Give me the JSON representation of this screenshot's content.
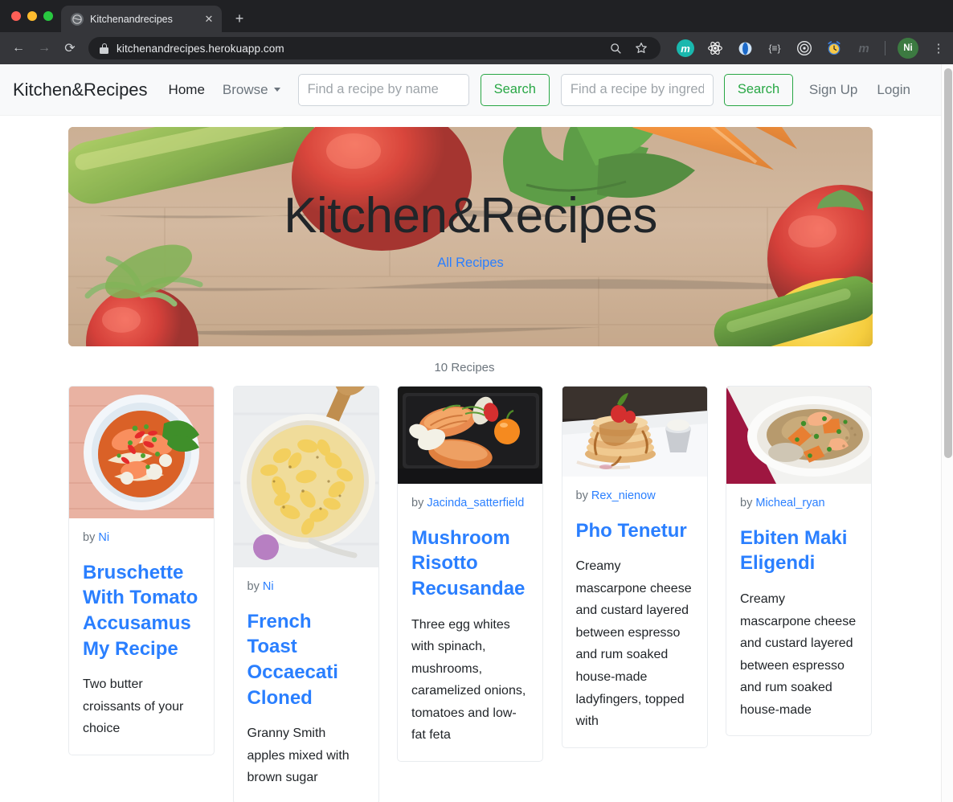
{
  "browser": {
    "tab": {
      "title": "Kitchenandrecipes",
      "favicon": "globe-icon",
      "close": "✕"
    },
    "new_tab": "+",
    "nav": {
      "back": "←",
      "forward": "→",
      "reload": "⟳"
    },
    "omnibox": {
      "url": "kitchenandrecipes.herokuapp.com",
      "lock": "lock-icon",
      "zoom_search": "⚲",
      "bookmark": "☆"
    },
    "extensions": [
      {
        "name": "mendeley-extension-icon",
        "glyph": "m"
      },
      {
        "name": "react-devtools-icon",
        "glyph": "⚛"
      },
      {
        "name": "opera-extension-icon",
        "glyph": "◐"
      },
      {
        "name": "code-extension-icon",
        "glyph": "{≡}"
      },
      {
        "name": "target-extension-icon",
        "glyph": "◎"
      },
      {
        "name": "alarm-clock-extension-icon",
        "glyph": "⏰"
      },
      {
        "name": "grayed-extension-icon",
        "glyph": "m"
      }
    ],
    "profile_initials": "Ni",
    "menu": "⋮"
  },
  "site": {
    "brand": "Kitchen&Recipes",
    "nav_items": [
      {
        "label": "Home",
        "muted": false
      },
      {
        "label": "Browse",
        "muted": true,
        "has_caret": true
      }
    ],
    "search_name": {
      "placeholder": "Find a recipe by name",
      "value": ""
    },
    "search_name_button": "Search",
    "search_ingredient": {
      "placeholder": "Find a recipe by ingredient",
      "value": ""
    },
    "search_ingredient_button": "Search",
    "auth": [
      {
        "label": "Sign Up"
      },
      {
        "label": "Login"
      }
    ]
  },
  "hero": {
    "title": "Kitchen&Recipes",
    "link": "All Recipes"
  },
  "results": {
    "count_label": "10 Recipes",
    "cards": [
      {
        "image": "noodle-soup-photo",
        "by_prefix": "by",
        "author": "Ni",
        "title": "Bruschette With Tomato Accusamus My Recipe",
        "description": "Two butter croissants of your choice"
      },
      {
        "image": "mac-and-cheese-photo",
        "by_prefix": "by",
        "author": "Ni",
        "title": "French Toast Occaecati Cloned",
        "description": "Granny Smith apples mixed with brown sugar"
      },
      {
        "image": "salmon-plate-photo",
        "by_prefix": "by",
        "author": "Jacinda_satterfield",
        "title": "Mushroom Risotto Recusandae",
        "description": "Three egg whites with spinach, mushrooms, caramelized onions, tomatoes and low-fat feta"
      },
      {
        "image": "pancake-stack-photo",
        "by_prefix": "by",
        "author": "Rex_nienow",
        "title": "Pho Tenetur",
        "description": "Creamy mascarpone cheese and custard layered between espresso and rum soaked house-made ladyfingers, topped with"
      },
      {
        "image": "shrimp-risotto-photo",
        "by_prefix": "by",
        "author": "Micheal_ryan",
        "title": "Ebiten Maki Eligendi",
        "description": "Creamy mascarpone cheese and custard layered between espresso and rum soaked house-made"
      }
    ]
  },
  "colors": {
    "link_blue": "#2a7fff",
    "accent_green": "#28a745",
    "navbar_bg": "#f8f9fa",
    "muted_text": "#6c757d"
  }
}
